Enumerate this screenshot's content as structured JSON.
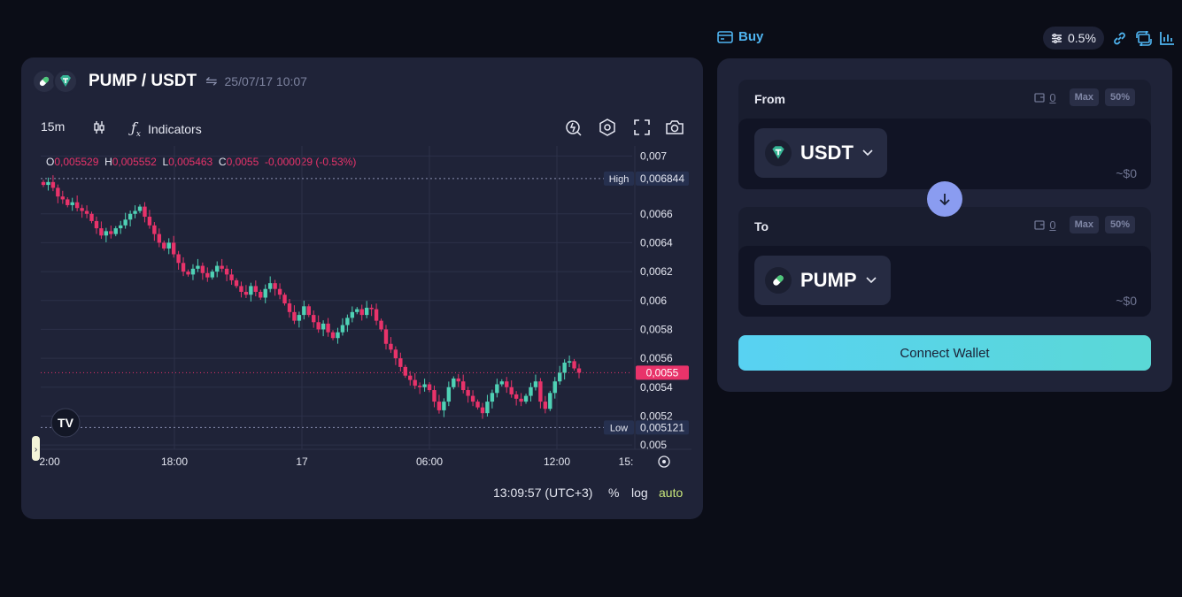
{
  "pair": {
    "title": "PUMP / USDT",
    "swap_icon": "swap-arrows-icon",
    "timestamp": "25/07/17 10:07",
    "base_icon": "pill-icon",
    "quote_icon": "tether-icon"
  },
  "toolbar": {
    "interval": "15m",
    "indicators_label": "Indicators",
    "icons": [
      "candles-icon",
      "fx-icon",
      "replay-icon",
      "settings-icon",
      "fullscreen-icon",
      "camera-icon"
    ]
  },
  "ohlc": {
    "o_label": "O",
    "o": "0,005529",
    "h_label": "H",
    "h": "0,005552",
    "l_label": "L",
    "l": "0,005463",
    "c_label": "C",
    "c": "0,0055",
    "change": "-0,000029 (-0.53%)"
  },
  "chart_data": {
    "type": "candlestick",
    "ylim": [
      0.00497,
      0.00707
    ],
    "y_ticks": [
      "0,007",
      "0,0066",
      "0,0064",
      "0,0062",
      "0,006",
      "0,0058",
      "0,0056",
      "0,0054",
      "0,0052",
      "0,005"
    ],
    "y_tick_values": [
      0.007,
      0.0066,
      0.0064,
      0.0062,
      0.006,
      0.0058,
      0.0056,
      0.0054,
      0.0052,
      0.005
    ],
    "x_ticks": [
      "2:00",
      "18:00",
      "17",
      "06:00",
      "12:00",
      "15:"
    ],
    "high_label": "High",
    "high_value": "0,006844",
    "high": 0.006844,
    "low_label": "Low",
    "low_value": "0,005121",
    "low": 0.005121,
    "last_value": "0,0055",
    "last": 0.0055,
    "up_color": "#4fd1b5",
    "down_color": "#e8336a",
    "closes": [
      0.0068,
      0.00682,
      0.00678,
      0.00672,
      0.0067,
      0.00666,
      0.00668,
      0.00664,
      0.00662,
      0.0066,
      0.00655,
      0.0065,
      0.00645,
      0.00648,
      0.00646,
      0.0065,
      0.00652,
      0.00656,
      0.0066,
      0.00662,
      0.00665,
      0.00658,
      0.00652,
      0.00646,
      0.0064,
      0.00636,
      0.0064,
      0.00632,
      0.00626,
      0.0062,
      0.00618,
      0.00622,
      0.00624,
      0.00619,
      0.00616,
      0.0062,
      0.00624,
      0.00622,
      0.00618,
      0.00614,
      0.0061,
      0.00606,
      0.00604,
      0.0061,
      0.00606,
      0.00602,
      0.00608,
      0.00612,
      0.00608,
      0.00604,
      0.00598,
      0.00592,
      0.00586,
      0.0059,
      0.00596,
      0.0059,
      0.00585,
      0.0058,
      0.00584,
      0.00578,
      0.00574,
      0.00578,
      0.00583,
      0.00588,
      0.00592,
      0.00594,
      0.0059,
      0.00595,
      0.00594,
      0.00586,
      0.0058,
      0.0057,
      0.00566,
      0.0056,
      0.00554,
      0.00548,
      0.00545,
      0.00541,
      0.0054,
      0.00542,
      0.00538,
      0.0053,
      0.00524,
      0.0053,
      0.0054,
      0.00546,
      0.00544,
      0.00538,
      0.00534,
      0.0053,
      0.00526,
      0.00522,
      0.0053,
      0.00536,
      0.00542,
      0.00544,
      0.0054,
      0.00535,
      0.00532,
      0.0053,
      0.00534,
      0.0054,
      0.00544,
      0.0053,
      0.00525,
      0.00536,
      0.00544,
      0.0055,
      0.00557,
      0.00558,
      0.00553,
      0.0055
    ]
  },
  "footer": {
    "clock": "13:09:57 (UTC+3)",
    "percent": "%",
    "log": "log",
    "auto": "auto"
  },
  "right_header": {
    "buy_label": "Buy",
    "slippage": "0.5%"
  },
  "swap": {
    "from": {
      "label": "From",
      "balance": "0",
      "max": "Max",
      "half": "50%",
      "token": "USDT",
      "usd": "~$0"
    },
    "to": {
      "label": "To",
      "balance": "0",
      "max": "Max",
      "half": "50%",
      "token": "PUMP",
      "usd": "~$0"
    },
    "connect_label": "Connect Wallet"
  }
}
